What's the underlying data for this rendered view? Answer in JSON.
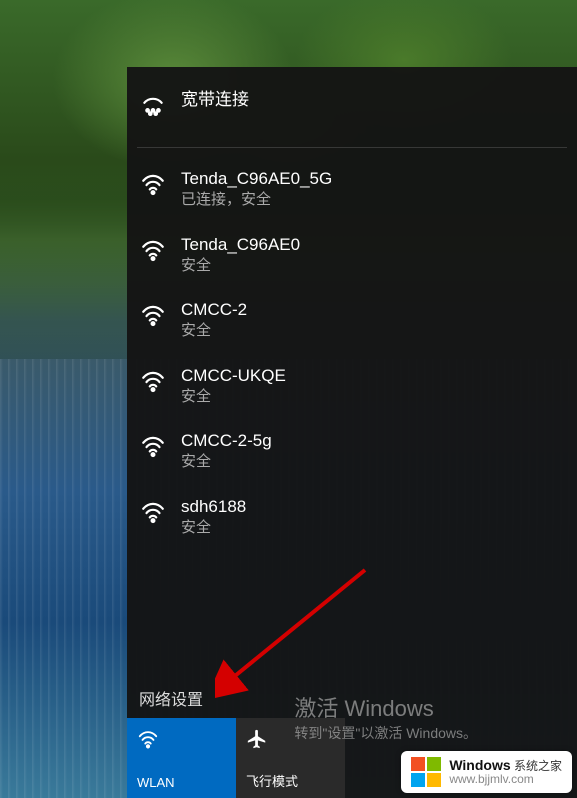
{
  "broadband": {
    "label": "宽带连接"
  },
  "networks": [
    {
      "name": "Tenda_C96AE0_5G",
      "status": "已连接，安全"
    },
    {
      "name": "Tenda_C96AE0",
      "status": "安全"
    },
    {
      "name": "CMCC-2",
      "status": "安全"
    },
    {
      "name": "CMCC-UKQE",
      "status": "安全"
    },
    {
      "name": "CMCC-2-5g",
      "status": "安全"
    },
    {
      "name": "sdh6188",
      "status": "安全"
    }
  ],
  "settings_link": "网络设置",
  "tiles": {
    "wlan": "WLAN",
    "airplane": "飞行模式"
  },
  "watermark": {
    "title": "激活 Windows",
    "sub": "转到\"设置\"以激活 Windows。"
  },
  "sitemark": {
    "brand": "Windows",
    "sub": "系统之家",
    "url": "www.bjjmlv.com"
  }
}
